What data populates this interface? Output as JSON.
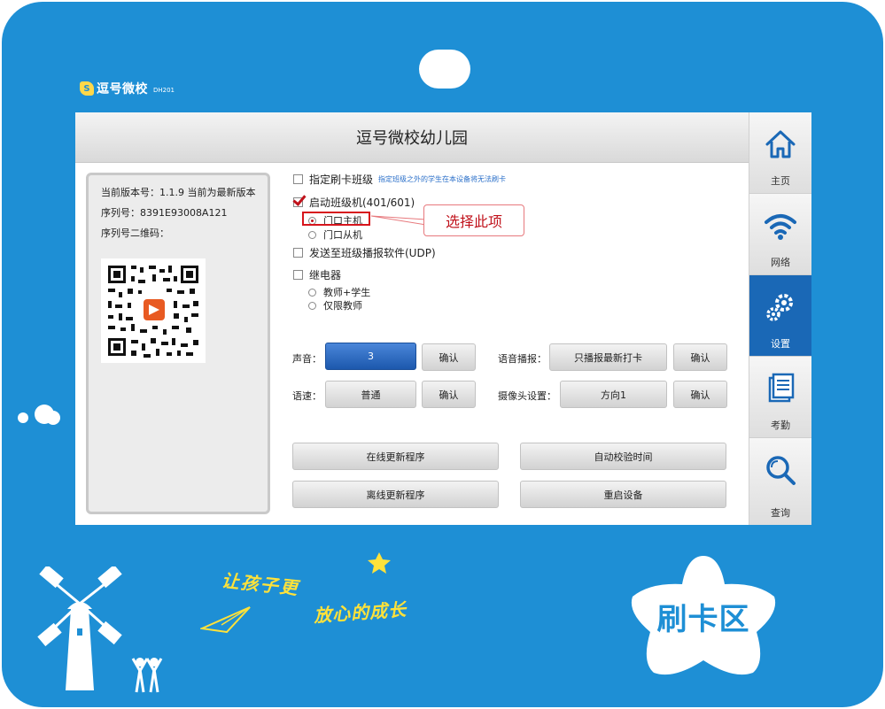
{
  "brand": {
    "mark": "S",
    "name": "逗号微校",
    "model": "DH201"
  },
  "screen": {
    "title": "逗号微校幼儿园"
  },
  "info": {
    "version_line": "当前版本号：1.1.9 当前为最新版本",
    "serial_line": "序列号：8391E93008A121",
    "qr_label": "序列号二维码："
  },
  "options": {
    "assign_class": {
      "label": "指定刷卡班级",
      "hint": "指定班级之外的学生在本设备将无法刷卡",
      "checked": false
    },
    "class_device": {
      "label": "启动班级机(401/601)",
      "checked": true
    },
    "door_master": {
      "label": "门口主机",
      "selected": true
    },
    "door_slave": {
      "label": "门口从机",
      "selected": false
    },
    "send_udp": {
      "label": "发送至班级播报软件(UDP)",
      "checked": false
    },
    "relay": {
      "label": "继电器",
      "checked": false
    },
    "teacher_student": {
      "label": "教师+学生",
      "selected": false
    },
    "teacher_only": {
      "label": "仅限教师",
      "selected": false
    }
  },
  "callout": {
    "text": "选择此项"
  },
  "settings": {
    "volume_label": "声音：",
    "volume_value": "3",
    "voice_label": "语音播报：",
    "voice_value": "只播报最新打卡",
    "speed_label": "语速：",
    "speed_value": "普通",
    "camera_label": "摄像头设置：",
    "camera_value": "方向1",
    "confirm": "确认"
  },
  "actions": {
    "online_update": "在线更新程序",
    "auto_time": "自动校验时间",
    "offline_update": "离线更新程序",
    "restart": "重启设备"
  },
  "nav": [
    {
      "label": "主页",
      "icon": "home-icon",
      "active": false
    },
    {
      "label": "网络",
      "icon": "wifi-icon",
      "active": false
    },
    {
      "label": "设置",
      "icon": "gear-icon",
      "active": true
    },
    {
      "label": "考勤",
      "icon": "attendance-icon",
      "active": false
    },
    {
      "label": "查询",
      "icon": "search-icon",
      "active": false
    }
  ],
  "footer": {
    "slogan_line1": "让孩子更",
    "slogan_line2": "放心的成长",
    "card_zone": "刷卡区"
  },
  "colors": {
    "frame": "#1e8fd5",
    "active_nav": "#1a68b6",
    "accent_red": "#c0121b",
    "slogan_yellow": "#ffe23a"
  }
}
